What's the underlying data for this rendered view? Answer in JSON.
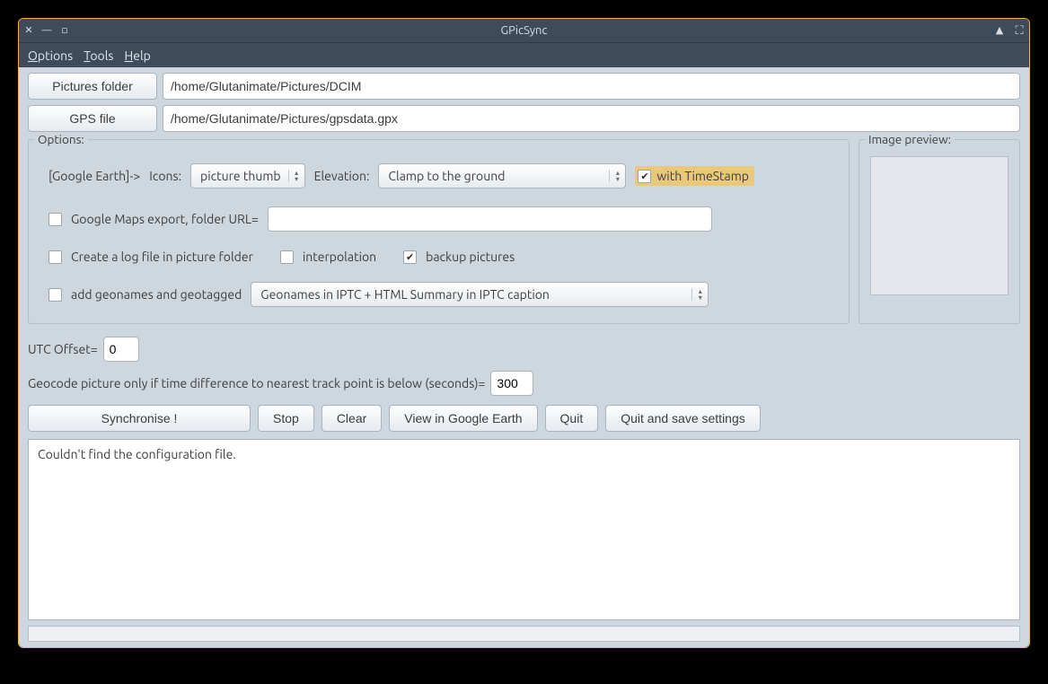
{
  "window": {
    "title": "GPicSync"
  },
  "menu": {
    "options": "Options",
    "tools": "Tools",
    "help": "Help"
  },
  "paths": {
    "pictures_btn": "Pictures folder",
    "pictures_val": "/home/Glutanimate/Pictures/DCIM",
    "gps_btn": "GPS file",
    "gps_val": "/home/Glutanimate/Pictures/gpsdata.gpx"
  },
  "options": {
    "panel_title": "Options:",
    "ge_prefix": "[Google Earth]->",
    "icons_label": "Icons:",
    "icons_value": "picture thumb",
    "elevation_label": "Elevation:",
    "elevation_value": "Clamp to the ground",
    "timestamp_label": "with TimeStamp",
    "timestamp_checked": true,
    "gmaps_label": "Google Maps export, folder URL=",
    "gmaps_checked": false,
    "gmaps_url": "",
    "logfile_label": "Create a log file in picture folder",
    "logfile_checked": false,
    "interpolation_label": "interpolation",
    "interpolation_checked": false,
    "backup_label": "backup pictures",
    "backup_checked": true,
    "geonames_label": "add geonames and geotagged",
    "geonames_checked": false,
    "geonames_mode": "Geonames in IPTC + HTML Summary in IPTC caption"
  },
  "preview": {
    "title": "Image preview:"
  },
  "utc": {
    "label": "UTC Offset=",
    "value": "0"
  },
  "geocode": {
    "label": "Geocode picture only if time difference to nearest track point is below (seconds)=",
    "value": "300"
  },
  "actions": {
    "sync": "Synchronise !",
    "stop": "Stop",
    "clear": "Clear",
    "view": "View in Google Earth",
    "quit": "Quit",
    "quitsave": "Quit and save settings"
  },
  "log": {
    "text": "Couldn't find the configuration file."
  }
}
